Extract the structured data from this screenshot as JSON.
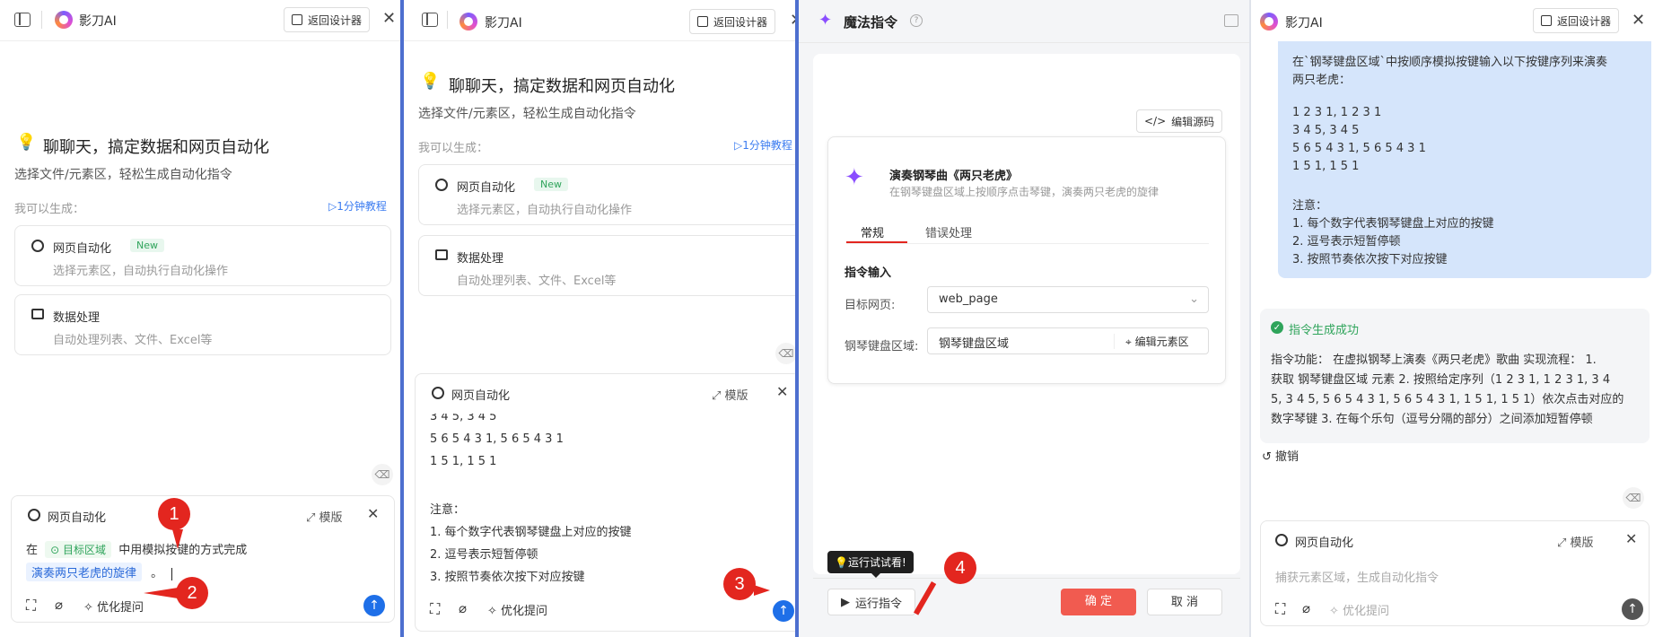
{
  "app": {
    "name": "影刀AI",
    "back_label": "返回设计器"
  },
  "welcome": {
    "title": "聊聊天，搞定数据和网页自动化",
    "subtitle": "选择文件/元素区，轻松生成自动化指令",
    "can_generate": "我可以生成：",
    "tutorial": "1分钟教程"
  },
  "cards": [
    {
      "title": "网页自动化",
      "badge": "New",
      "desc": "选择元素区，自动执行自动化操作"
    },
    {
      "title": "数据处理",
      "desc": "自动处理列表、文件、Excel等"
    }
  ],
  "composer": {
    "mode": "网页自动化",
    "template": "模版",
    "prefix": "在",
    "target_chip": "目标区域",
    "middle": "中用模拟按键的方式完成",
    "song_chip": "演奏两只老虎的旋律",
    "tail": "。",
    "optimize": "优化提问",
    "placeholder": "捕获元素区域，生成自动化指令"
  },
  "p2_composer_lines": [
    "3 4 5, 3 4 5",
    "5 6 5 4 3 1, 5 6 5 4 3 1",
    "1 5 1, 1 5 1",
    "",
    "注意：",
    "1. 每个数字代表钢琴键盘上对应的按键",
    "2. 逗号表示短暂停顿",
    "3. 按照节奏依次按下对应按键"
  ],
  "magic": {
    "title": "魔法指令",
    "edit_source": "编辑源码",
    "cmd_title": "演奏钢琴曲《两只老虎》",
    "cmd_desc": "在钢琴键盘区域上按顺序点击琴键，演奏两只老虎的旋律",
    "tabs": [
      "常规",
      "错误处理"
    ],
    "section": "指令输入",
    "target_label": "目标网页:",
    "target_value": "web_page",
    "piano_label": "钢琴键盘区域:",
    "piano_value": "钢琴键盘区域",
    "edit_element": "编辑元素区",
    "tooltip": "运行试试看!",
    "run": "运行指令",
    "ok": "确 定",
    "cancel": "取 消"
  },
  "chat": {
    "user_lines": [
      "在`钢琴键盘区域`中按顺序模拟按键输入以下按键序列来演奏",
      "两只老虎：",
      "",
      "1 2 3 1, 1 2 3 1",
      "3 4 5, 3 4 5",
      "5 6 5 4 3 1, 5 6 5 4 3 1",
      "1 5 1, 1 5 1",
      "",
      "注意：",
      "1. 每个数字代表钢琴键盘上对应的按键",
      "2. 逗号表示短暂停顿",
      "3. 按照节奏依次按下对应按键"
    ],
    "success": "指令生成成功",
    "result_lines": [
      "指令功能： 在虚拟钢琴上演奏《两只老虎》歌曲 实现流程： 1.",
      "获取 钢琴键盘区域 元素 2. 按照给定序列（1 2 3 1, 1 2 3 1, 3 4",
      "5, 3 4 5, 5 6 5 4 3 1, 5 6 5 4 3 1, 1 5 1, 1 5 1）依次点击对应的",
      "数字琴键 3. 在每个乐句（逗号分隔的部分）之间添加短暂停顿"
    ],
    "undo": "撤销"
  },
  "steps": [
    "1",
    "2",
    "3",
    "4"
  ]
}
